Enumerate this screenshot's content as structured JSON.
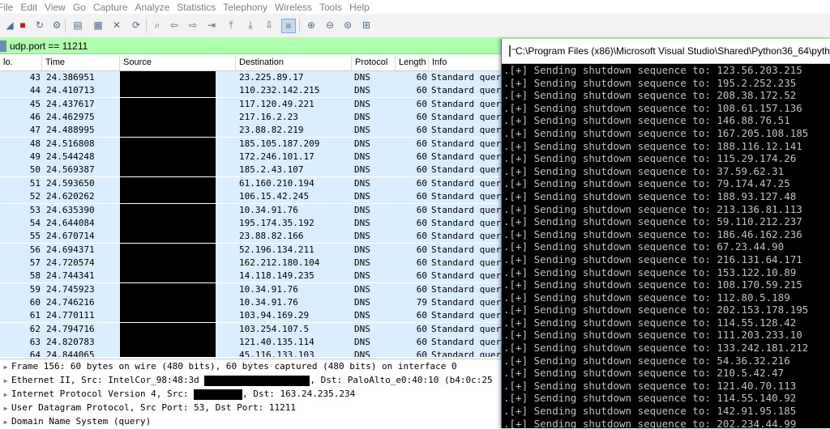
{
  "menu": [
    "File",
    "Edit",
    "View",
    "Go",
    "Capture",
    "Analyze",
    "Statistics",
    "Telephony",
    "Wireless",
    "Tools",
    "Help"
  ],
  "toolbar_icons": [
    "shark-fin-icon",
    "stop-icon",
    "restart-icon",
    "options-icon",
    "open-icon",
    "save-icon",
    "close-file-icon",
    "reload-icon",
    "find-icon",
    "back-icon",
    "forward-icon",
    "goto-icon",
    "first-icon",
    "last-icon",
    "autoscroll-icon",
    "colorize-icon",
    "zoom-in-icon",
    "zoom-out-icon",
    "normal-size-icon",
    "resize-columns-icon"
  ],
  "filter": {
    "value": "udp.port == 11211"
  },
  "columns": [
    "lo.",
    "Time",
    "Source",
    "Destination",
    "Protocol",
    "Length",
    "Info"
  ],
  "packets": [
    {
      "no": "43",
      "time": "24.386951",
      "dst": "23.225.89.17",
      "proto": "DNS",
      "len": "60",
      "info": "Standard quer"
    },
    {
      "no": "44",
      "time": "24.410713",
      "dst": "110.232.142.215",
      "proto": "DNS",
      "len": "60",
      "info": "Standard quer"
    },
    {
      "no": "45",
      "time": "24.437617",
      "dst": "117.120.49.221",
      "proto": "DNS",
      "len": "60",
      "info": "Standard quer"
    },
    {
      "no": "46",
      "time": "24.462975",
      "dst": "217.16.2.23",
      "proto": "DNS",
      "len": "60",
      "info": "Standard quer"
    },
    {
      "no": "47",
      "time": "24.488995",
      "dst": "23.88.82.219",
      "proto": "DNS",
      "len": "60",
      "info": "Standard quer"
    },
    {
      "no": "48",
      "time": "24.516808",
      "dst": "185.105.187.209",
      "proto": "DNS",
      "len": "60",
      "info": "Standard quer"
    },
    {
      "no": "49",
      "time": "24.544248",
      "dst": "172.246.101.17",
      "proto": "DNS",
      "len": "60",
      "info": "Standard quer"
    },
    {
      "no": "50",
      "time": "24.569387",
      "dst": "185.2.43.107",
      "proto": "DNS",
      "len": "60",
      "info": "Standard quer"
    },
    {
      "no": "51",
      "time": "24.593650",
      "dst": "61.160.210.194",
      "proto": "DNS",
      "len": "60",
      "info": "Standard quer"
    },
    {
      "no": "52",
      "time": "24.620262",
      "dst": "106.15.42.245",
      "proto": "DNS",
      "len": "60",
      "info": "Standard quer"
    },
    {
      "no": "53",
      "time": "24.635390",
      "dst": "10.34.91.76",
      "proto": "DNS",
      "len": "60",
      "info": "Standard quer"
    },
    {
      "no": "54",
      "time": "24.644084",
      "dst": "195.174.35.192",
      "proto": "DNS",
      "len": "60",
      "info": "Standard quer"
    },
    {
      "no": "55",
      "time": "24.670714",
      "dst": "23.88.82.166",
      "proto": "DNS",
      "len": "60",
      "info": "Standard quer"
    },
    {
      "no": "56",
      "time": "24.694371",
      "dst": "52.196.134.211",
      "proto": "DNS",
      "len": "60",
      "info": "Standard quer"
    },
    {
      "no": "57",
      "time": "24.720574",
      "dst": "162.212.180.104",
      "proto": "DNS",
      "len": "60",
      "info": "Standard quer"
    },
    {
      "no": "58",
      "time": "24.744341",
      "dst": "14.118.149.235",
      "proto": "DNS",
      "len": "60",
      "info": "Standard quer"
    },
    {
      "no": "59",
      "time": "24.745923",
      "dst": "10.34.91.76",
      "proto": "DNS",
      "len": "60",
      "info": "Standard quer"
    },
    {
      "no": "60",
      "time": "24.746216",
      "dst": "10.34.91.76",
      "proto": "DNS",
      "len": "79",
      "info": "Standard quer"
    },
    {
      "no": "61",
      "time": "24.770111",
      "dst": "103.94.169.29",
      "proto": "DNS",
      "len": "60",
      "info": "Standard quer"
    },
    {
      "no": "62",
      "time": "24.794716",
      "dst": "103.254.107.5",
      "proto": "DNS",
      "len": "60",
      "info": "Standard quer"
    },
    {
      "no": "63",
      "time": "24.820783",
      "dst": "121.40.135.114",
      "proto": "DNS",
      "len": "60",
      "info": "Standard quer"
    },
    {
      "no": "64",
      "time": "24.844065",
      "dst": "45.116.133.103",
      "proto": "DNS",
      "len": "60",
      "info": "Standard quer"
    }
  ],
  "details": [
    {
      "a": "Frame 156: 60 bytes on wire (480 bits), 60 bytes captured (480 bits) on interface 0",
      "b": ""
    },
    {
      "a": "Ethernet II, Src: IntelCor_98:48:3d ",
      "b": ", Dst: PaloAlto_e0:40:10 (b4:0c:25"
    },
    {
      "a": "Internet Protocol Version 4, Src: ",
      "b": ", Dst: 163.24.235.234"
    },
    {
      "a": "User Datagram Protocol, Src Port: 53, Dst Port: 11211",
      "b": ""
    },
    {
      "a": "Domain Name System (query)",
      "b": ""
    }
  ],
  "console": {
    "title": "C:\\Program Files (x86)\\Microsoft Visual Studio\\Shared\\Python36_64\\pytho",
    "prefix": ".[+] Sending shutdown sequence to: ",
    "ips": [
      "123.56.203.215",
      "195.2.252.235",
      "208.38.172.52",
      "108.61.157.136",
      "146.88.76.51",
      "167.205.108.185",
      "188.116.12.141",
      "115.29.174.26",
      "37.59.62.31",
      "79.174.47.25",
      "188.93.127.48",
      "213.136.81.113",
      "59.110.212.237",
      "186.46.162.236",
      "67.23.44.90",
      "216.131.64.171",
      "153.122.10.89",
      "108.170.59.215",
      "112.80.5.189",
      "202.153.178.195",
      "114.55.128.42",
      "111.203.233.10",
      "133.242.181.212",
      "54.36.32.216",
      "210.5.42.47",
      "121.40.70.113",
      "114.55.140.92",
      "142.91.95.185",
      "202.234.44.99"
    ]
  },
  "colors": {
    "filter_bg": "#afffaf",
    "row_bg": "#daeeff",
    "console_bg": "#000000",
    "console_text": "#c0c0c0"
  }
}
